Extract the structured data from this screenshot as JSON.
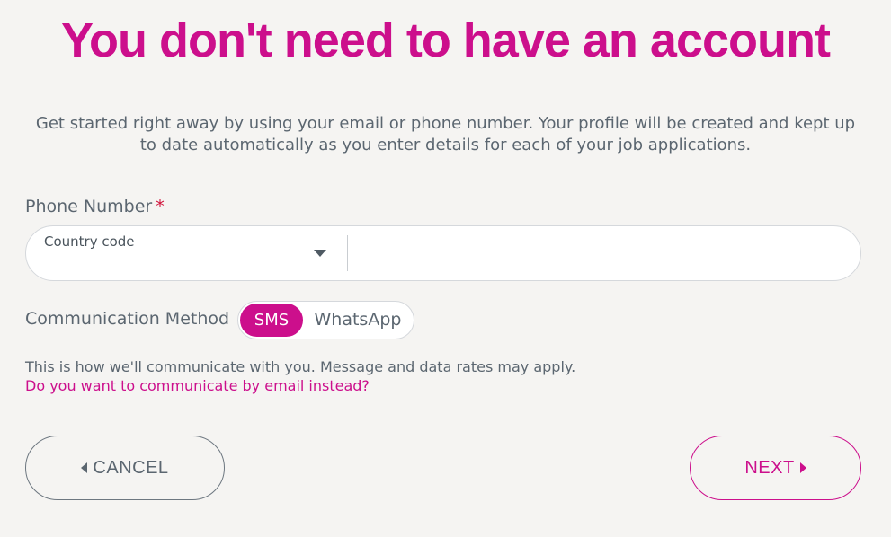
{
  "heading": "You don't need to have an account",
  "intro": "Get started right away by using your email or phone number. Your profile will be created and kept up to date automatically as you enter details for each of your job applications.",
  "phone": {
    "label": "Phone Number",
    "required_mark": "*",
    "country_code_label": "Country code",
    "value": ""
  },
  "communication": {
    "label": "Communication Method",
    "options": [
      "SMS",
      "WhatsApp"
    ],
    "selected": "SMS"
  },
  "note": "This is how we'll communicate with you. Message and data rates may apply.",
  "email_link": "Do you want to communicate by email instead?",
  "buttons": {
    "cancel": "CANCEL",
    "next": "NEXT"
  },
  "colors": {
    "accent": "#cc0f8c",
    "text": "#5b6670",
    "background": "#f5f4f2"
  }
}
